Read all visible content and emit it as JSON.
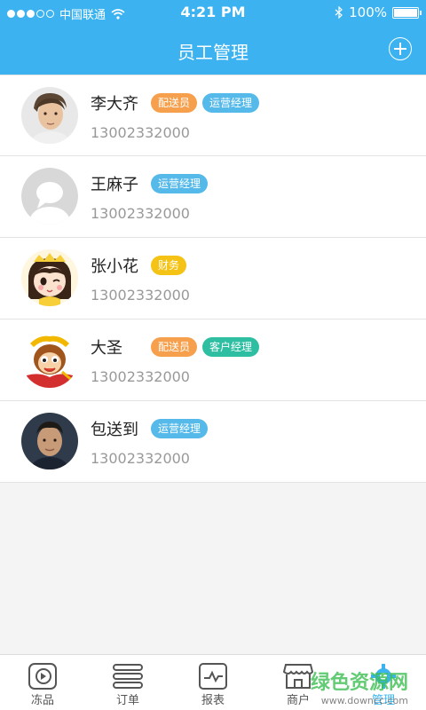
{
  "status_bar": {
    "carrier": "中国联通",
    "time": "4:21 PM",
    "battery": "100%"
  },
  "header": {
    "title": "员工管理",
    "add_icon": "plus-circle-icon"
  },
  "employees": [
    {
      "name": "李大齐",
      "phone": "13002332000",
      "avatar": "photo-avatar-man-1",
      "tags": [
        {
          "label": "配送员",
          "color": "#f6a04d"
        },
        {
          "label": "运营经理",
          "color": "#55b9ea"
        }
      ]
    },
    {
      "name": "王麻子",
      "phone": "13002332000",
      "avatar": "default-user-icon",
      "tags": [
        {
          "label": "运营经理",
          "color": "#55b9ea"
        }
      ]
    },
    {
      "name": "张小花",
      "phone": "13002332000",
      "avatar": "cartoon-girl-avatar",
      "tags": [
        {
          "label": "财务",
          "color": "#f5c315"
        }
      ]
    },
    {
      "name": "大圣",
      "phone": "13002332000",
      "avatar": "cartoon-monkey-avatar",
      "tags": [
        {
          "label": "配送员",
          "color": "#f6a04d"
        },
        {
          "label": "客户经理",
          "color": "#2ebfa2"
        }
      ]
    },
    {
      "name": "包送到",
      "phone": "13002332000",
      "avatar": "photo-avatar-man-2",
      "tags": [
        {
          "label": "运营经理",
          "color": "#55b9ea"
        }
      ]
    }
  ],
  "tabbar": {
    "items": [
      {
        "label": "冻品",
        "icon": "frozen-goods-icon"
      },
      {
        "label": "订单",
        "icon": "orders-icon"
      },
      {
        "label": "报表",
        "icon": "report-icon"
      },
      {
        "label": "商户",
        "icon": "shop-icon"
      },
      {
        "label": "管理",
        "icon": "gear-icon",
        "active": true
      }
    ]
  },
  "watermark": {
    "text": "绿色资源网",
    "url": "www.downcc.com"
  }
}
